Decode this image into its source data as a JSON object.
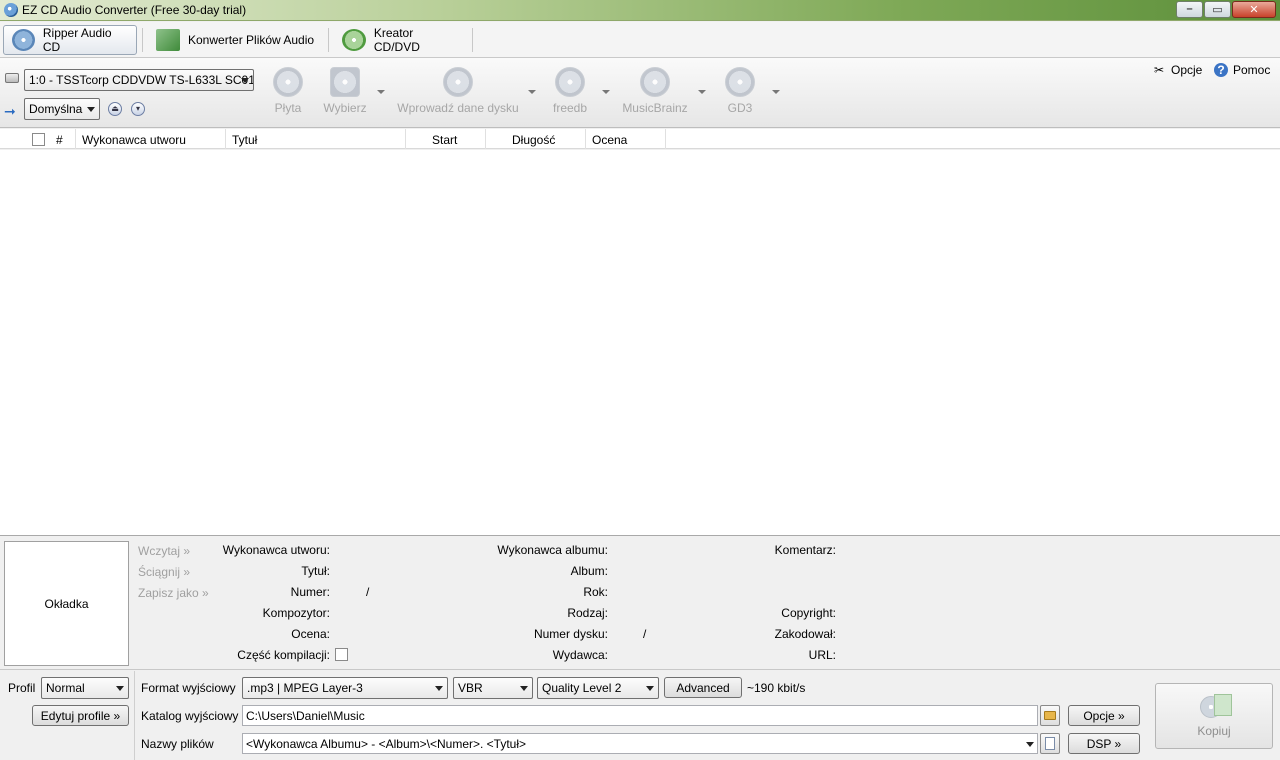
{
  "window": {
    "title": "EZ CD Audio Converter (Free 30-day trial)"
  },
  "tabs": [
    {
      "label": "Ripper Audio CD",
      "active": true
    },
    {
      "label": "Konwerter Plików Audio",
      "active": false
    },
    {
      "label": "Kreator CD/DVD",
      "active": false
    }
  ],
  "toolbar": {
    "drive": "1:0 - TSSTcorp CDDVDW TS-L633L SC01",
    "preset": "Domyślna",
    "tools": [
      "Płyta",
      "Wybierz",
      "Wprowadź dane dysku",
      "freedb",
      "MusicBrainz",
      "GD3"
    ],
    "options_label": "Opcje",
    "help_label": "Pomoc"
  },
  "tracklist": {
    "columns": [
      "#",
      "Wykonawca utworu",
      "Tytuł",
      "Start",
      "Długość",
      "Ocena"
    ],
    "rows": []
  },
  "metadata": {
    "cover_label": "Okładka",
    "links": [
      "Wczytaj »",
      "Ściągnij »",
      "Zapisz jako »"
    ],
    "col1": [
      "Wykonawca utworu:",
      "Tytuł:",
      "Numer:",
      "Kompozytor:",
      "Ocena:",
      "Część kompilacji:"
    ],
    "col2": [
      "Wykonawca albumu:",
      "Album:",
      "Rok:",
      "Rodzaj:",
      "Numer dysku:",
      "Wydawca:"
    ],
    "col3": [
      "Komentarz:",
      "Copyright:",
      "Zakodował:",
      "URL:"
    ],
    "slash": "/"
  },
  "output": {
    "profile_label": "Profil",
    "profile_value": "Normal",
    "edit_profiles_label": "Edytuj profile »",
    "format_label": "Format wyjściowy",
    "format_value": ".mp3 | MPEG Layer-3",
    "mode_value": "VBR",
    "quality_value": "Quality Level 2",
    "advanced_label": "Advanced",
    "bitrate_text": "~190 kbit/s",
    "dir_label": "Katalog wyjściowy",
    "dir_value": "C:\\Users\\Daniel\\Music",
    "options_label": "Opcje »",
    "filenames_label": "Nazwy plików",
    "filenames_value": "<Wykonawca Albumu> - <Album>\\<Numer>. <Tytuł>",
    "dsp_label": "DSP »",
    "copy_label": "Kopiuj"
  }
}
